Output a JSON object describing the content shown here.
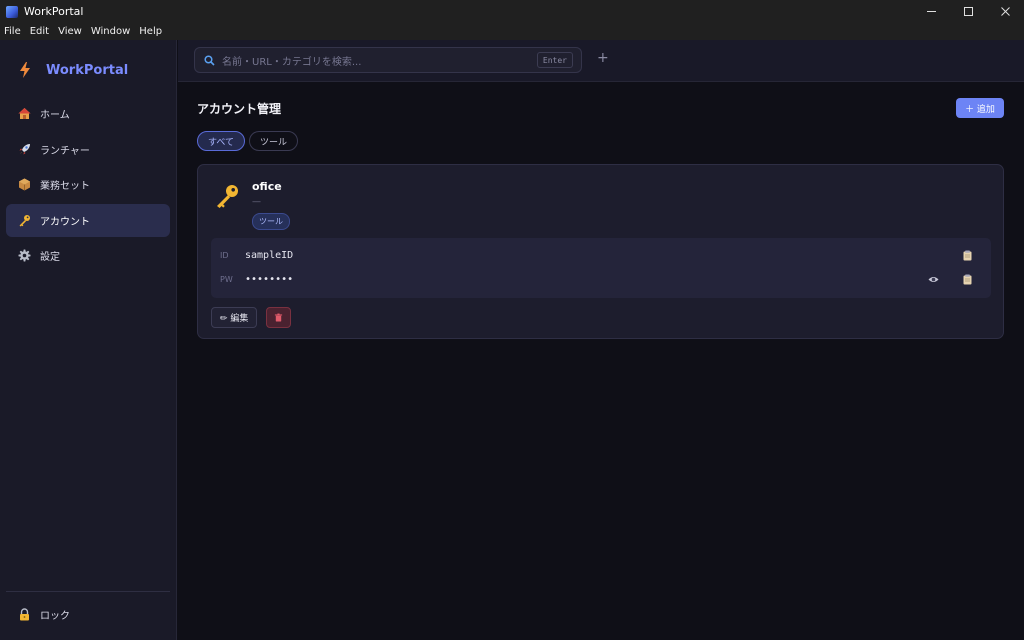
{
  "window": {
    "title": "WorkPortal"
  },
  "menu": [
    "File",
    "Edit",
    "View",
    "Window",
    "Help"
  ],
  "sidebar": {
    "brand": "WorkPortal",
    "items": [
      {
        "label": "ホーム",
        "icon": "house-icon"
      },
      {
        "label": "ランチャー",
        "icon": "rocket-icon"
      },
      {
        "label": "業務セット",
        "icon": "package-icon"
      },
      {
        "label": "アカウント",
        "icon": "key-icon",
        "active": true
      },
      {
        "label": "設定",
        "icon": "gear-icon"
      }
    ],
    "lock_label": "ロック"
  },
  "search": {
    "placeholder": "名前・URL・カテゴリを検索...",
    "enter_hint": "Enter",
    "new_tab": "+"
  },
  "page": {
    "title": "アカウント管理",
    "add_label": "＋ 追加",
    "filters": [
      {
        "label": "すべて",
        "active": true
      },
      {
        "label": "ツール",
        "active": false
      }
    ]
  },
  "accounts": [
    {
      "name": "ofice",
      "subtitle": "—",
      "tag": "ツール",
      "id_key": "ID",
      "id_value": "sampleID",
      "pw_key": "PW",
      "pw_value": "••••••••",
      "edit_label": "✏ 編集"
    }
  ],
  "colors": {
    "accent": "#6d84f5",
    "brand": "#7b8cff",
    "danger": "#4a2230"
  }
}
